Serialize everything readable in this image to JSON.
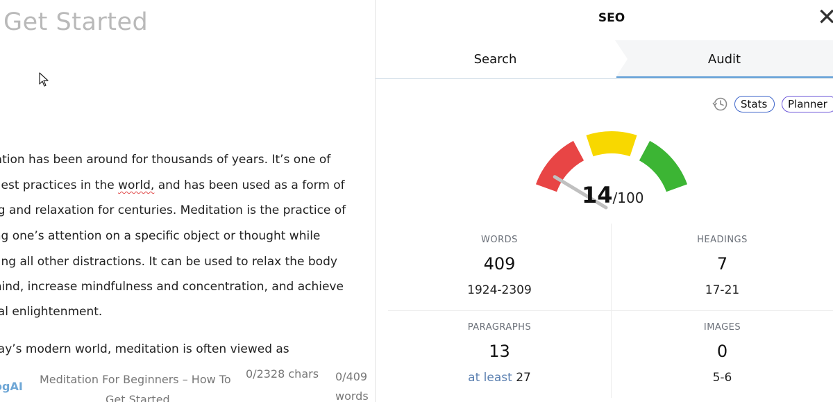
{
  "editor": {
    "title": "Get Started",
    "lines": [
      "tation has been around for thousands of years. It’s one of",
      "ldest practices in the ",
      "ng and relaxation for centuries. Meditation is the practice of",
      "ing one’s attention on a specific object or thought while",
      "ding all other distractions. It can be used to relax the body",
      "mind, increase mindfulness and concentration, and achieve",
      "ual enlightenment.",
      "day’s modern world, meditation is often viewed as"
    ],
    "line2_misspelled": "world,",
    "line2_rest": " and has been used as a form of",
    "footer": {
      "brand": "ogAI",
      "doc_title_line1": "Meditation For Beginners – How To",
      "doc_title_line2": "Get Started",
      "chars": "0/2328  chars",
      "words_count": "0/409",
      "words_label": "words"
    }
  },
  "panel": {
    "title": "SEO",
    "close_icon": "close-x-icon",
    "tabs": [
      {
        "label": "Search",
        "active": false
      },
      {
        "label": "Audit",
        "active": true
      }
    ],
    "toolbar": {
      "history_icon": "history-clock-icon",
      "stats_label": "Stats",
      "planner_label": "Planner"
    },
    "gauge": {
      "score": "14",
      "max": "/100",
      "score_value": 14,
      "max_value": 100,
      "colors": {
        "low": "#e84545",
        "mid": "#f8d800",
        "high": "#3cb534",
        "needle": "#c0c0c0"
      }
    },
    "stats": {
      "words": {
        "label": "WORDS",
        "value": "409",
        "range": "1924-2309"
      },
      "headings": {
        "label": "HEADINGS",
        "value": "7",
        "range": "17-21"
      },
      "paragraphs": {
        "label": "PARAGRAPHS",
        "value": "13",
        "range_prefix": "at least",
        "range": "27"
      },
      "images": {
        "label": "IMAGES",
        "value": "0",
        "range": "5-6"
      }
    }
  }
}
